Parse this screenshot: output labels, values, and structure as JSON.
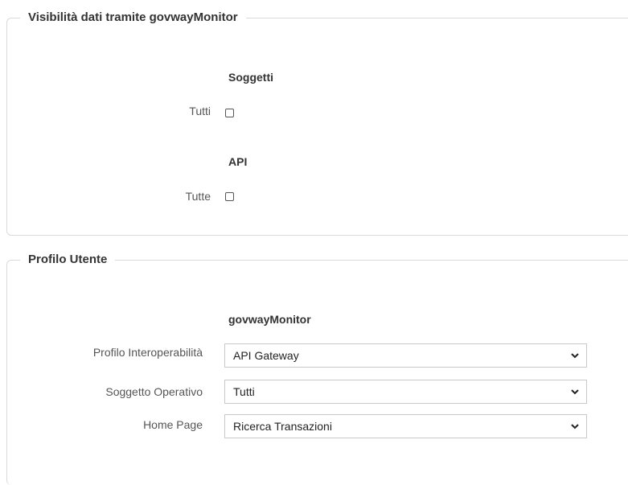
{
  "visibility_section": {
    "title": "Visibilità dati tramite govwayMonitor",
    "subjects_header": "Soggetti",
    "subjects_all_label": "Tutti",
    "subjects_all_checked": false,
    "api_header": "API",
    "api_all_label": "Tutte",
    "api_all_checked": false
  },
  "profile_section": {
    "title": "Profilo Utente",
    "subheader": "govwayMonitor",
    "fields": [
      {
        "label": "Profilo Interoperabilità",
        "value": "API Gateway"
      },
      {
        "label": "Soggetto Operativo",
        "value": "Tutti"
      },
      {
        "label": "Home Page",
        "value": "Ricerca Transazioni"
      }
    ]
  },
  "icons": {
    "dropdown": "chevron-down-icon"
  }
}
